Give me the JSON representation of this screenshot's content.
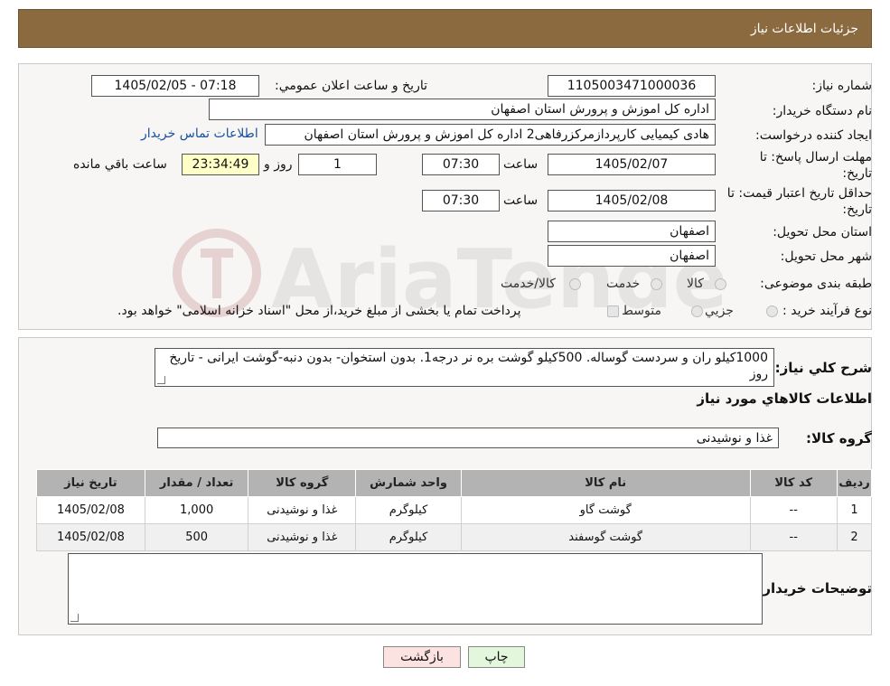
{
  "header": {
    "title": "جزئیات اطلاعات نیاز"
  },
  "fields": {
    "need_number_label": "شماره نیاز:",
    "need_number": "1105003471000036",
    "announce_label": "تاریخ و ساعت اعلان عمومي:",
    "announce_value": "1405/02/05 - 07:18",
    "buyer_label": "نام دستگاه خريدار:",
    "buyer_value": "اداره کل اموزش و پرورش استان اصفهان",
    "creator_label": "ايجاد کننده درخواست:",
    "creator_value": "هادی کیمیایی کارپردازمرکزرفاهی2 اداره کل اموزش و پرورش استان اصفهان",
    "contact_link": "اطلاعات تماس خريدار",
    "deadline_label_1": "مهلت ارسال پاسخ: تا",
    "deadline_label_2": "تاریخ:",
    "deadline_date": "1405/02/07",
    "time_label": "ساعت",
    "deadline_time": "07:30",
    "days_value": "1",
    "days_label": "روز و",
    "remaining_value": "23:34:49",
    "remaining_label": "ساعت باقي مانده",
    "validity_label_1": "حداقل تاريخ اعتبار قيمت: تا",
    "validity_label_2": "تاريخ:",
    "validity_date": "1405/02/08",
    "validity_time": "07:30",
    "province_label": "استان محل تحويل:",
    "province_value": "اصفهان",
    "city_label": "شهر محل تحويل:",
    "city_value": "اصفهان",
    "category_label": "طبقه بندی موضوعی:",
    "category_options": [
      "کالا",
      "خدمت",
      "کالا/خدمت"
    ],
    "process_label": "نوع فرآيند خريد :",
    "process_options": [
      "جزيي",
      "متوسط"
    ],
    "process_note": "پرداخت تمام يا بخشی از مبلغ خريد،از محل \"اسناد خزانه اسلامی\" خواهد بود."
  },
  "description": {
    "label": "شرح کلي نياز:",
    "text": "1000کیلو ران و سردست گوساله. 500کیلو گوشت بره نر درجه1. بدون استخوان- بدون دنبه-گوشت ایرانی - تاریخ روز"
  },
  "items_section": {
    "title": "اطلاعات کالاهاي مورد نياز",
    "group_label": "گروه کالا:",
    "group_value": "غذا و نوشيدنی"
  },
  "table": {
    "headers": [
      "رديف",
      "کد کالا",
      "نام کالا",
      "واحد شمارش",
      "گروه کالا",
      "تعداد / مقدار",
      "تاريخ نياز"
    ],
    "rows": [
      [
        "1",
        "--",
        "گوشت گاو",
        "کيلوگرم",
        "غذا و نوشيدنی",
        "1,000",
        "1405/02/08"
      ],
      [
        "2",
        "--",
        "گوشت گوسفند",
        "کيلوگرم",
        "غذا و نوشيدنی",
        "500",
        "1405/02/08"
      ]
    ]
  },
  "buyer_notes": {
    "label": "توضيحات خريدار:",
    "text": ""
  },
  "buttons": {
    "print": "چاپ",
    "back": "بازگشت"
  },
  "colors": {
    "header_bg": "#8c6a3f",
    "print_bg": "#e3f7dc",
    "back_bg": "#fde2e2",
    "link": "#1a4fa0"
  }
}
